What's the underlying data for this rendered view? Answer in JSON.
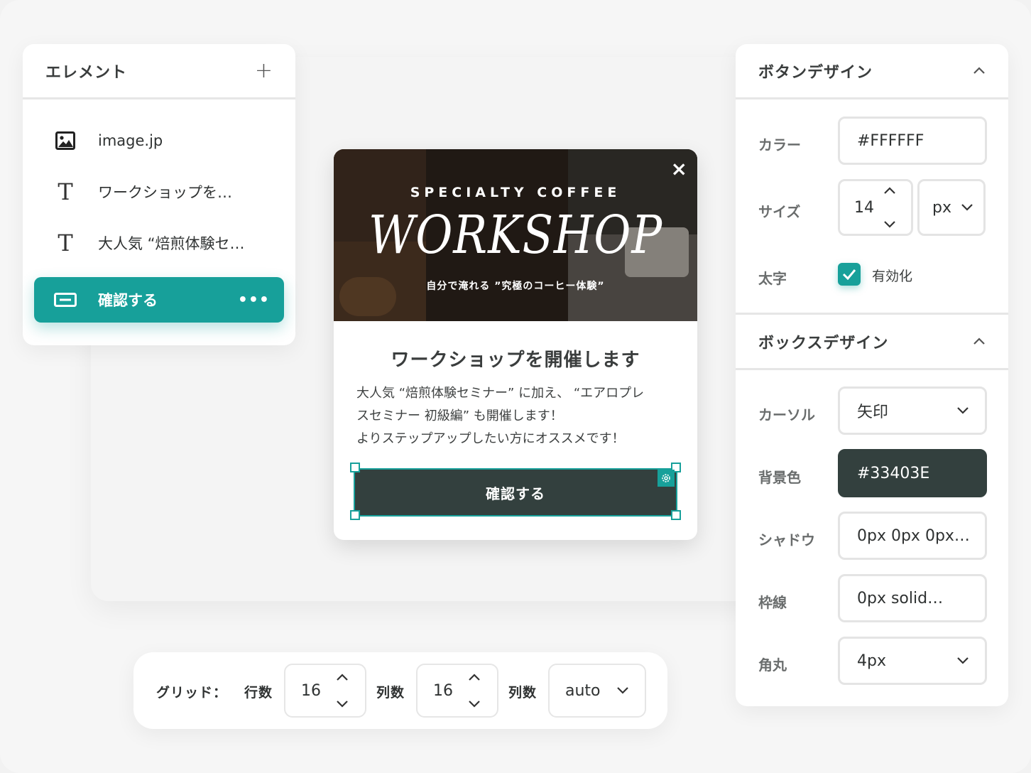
{
  "elements_panel": {
    "title": "エレメント",
    "add_icon": "plus-icon",
    "items": [
      {
        "label": "image.jp",
        "icon": "image-icon"
      },
      {
        "label": "ワークショップを…",
        "icon": "text-icon"
      },
      {
        "label": "大人気 “焙煎体験セ…",
        "icon": "text-icon"
      },
      {
        "label": "確認する",
        "icon": "button-icon",
        "active": true
      }
    ],
    "more_label": "•••"
  },
  "modal": {
    "hero_top": "SPECIALTY COFFEE",
    "hero_main": "WORKSHOP",
    "hero_sub": "自分で淹れる ”究極のコーヒー体験”",
    "close_icon": "×",
    "title": "ワークショップを開催します",
    "body_lines": [
      "大人気 “焙煎体験セミナー” に加え、 “エアロプレ",
      "スセミナー 初級編” も開催します！",
      "よりステップアップしたい方にオススメです！"
    ],
    "button_label": "確認する"
  },
  "button_design": {
    "title": "ボタンデザイン",
    "color_label": "カラー",
    "color_value": "#FFFFFF",
    "size_label": "サイズ",
    "size_value": "14",
    "size_unit": "px",
    "bold_label": "太字",
    "bold_checkbox_label": "有効化",
    "bold_checked": true
  },
  "box_design": {
    "title": "ボックスデザイン",
    "cursor_label": "カーソル",
    "cursor_value": "矢印",
    "bg_label": "背景色",
    "bg_value": "#33403E",
    "shadow_label": "シャドウ",
    "shadow_value": "0px 0px 0px…",
    "border_label": "枠線",
    "border_value": "0px solid…",
    "radius_label": "角丸",
    "radius_value": "4px"
  },
  "grid_bar": {
    "label": "グリッド：",
    "rows_label": "行数",
    "rows_value": "16",
    "cols_label": "列数",
    "cols_value": "16",
    "cols2_label": "列数",
    "auto_value": "auto"
  },
  "colors": {
    "accent": "#17A09A",
    "button_bg": "#33403E"
  }
}
